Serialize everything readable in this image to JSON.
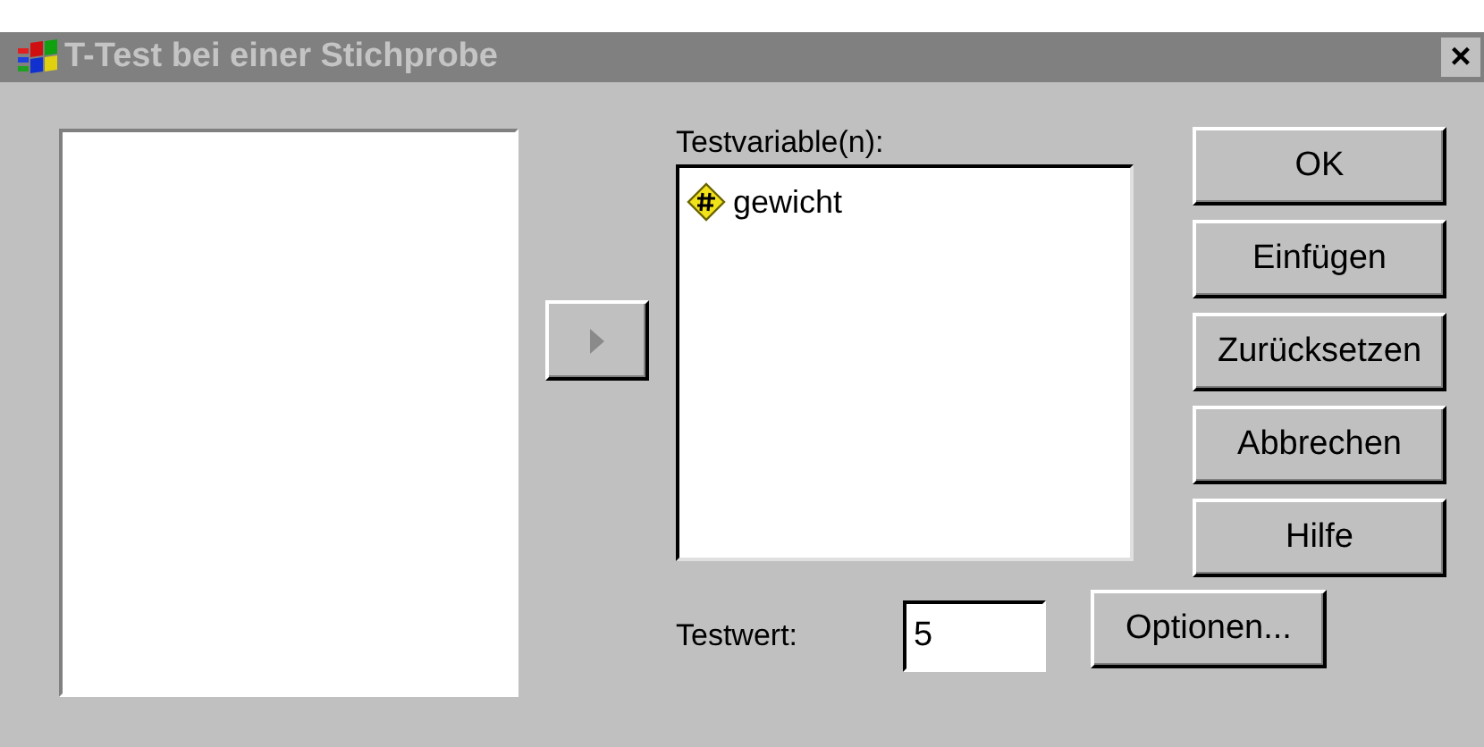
{
  "window": {
    "title": "T-Test bei einer Stichprobe",
    "active": false,
    "close": "×"
  },
  "move_button": {
    "disabled": true
  },
  "test_variables": {
    "label": "Testvariable(n):",
    "items": [
      {
        "name": "gewicht",
        "selected": false
      }
    ]
  },
  "test_value": {
    "label": "Testwert:",
    "value": "5"
  },
  "options_button": "Optionen...",
  "buttons": [
    "OK",
    "Einfügen",
    "Zurücksetzen",
    "Abbrechen",
    "Hilfe"
  ]
}
